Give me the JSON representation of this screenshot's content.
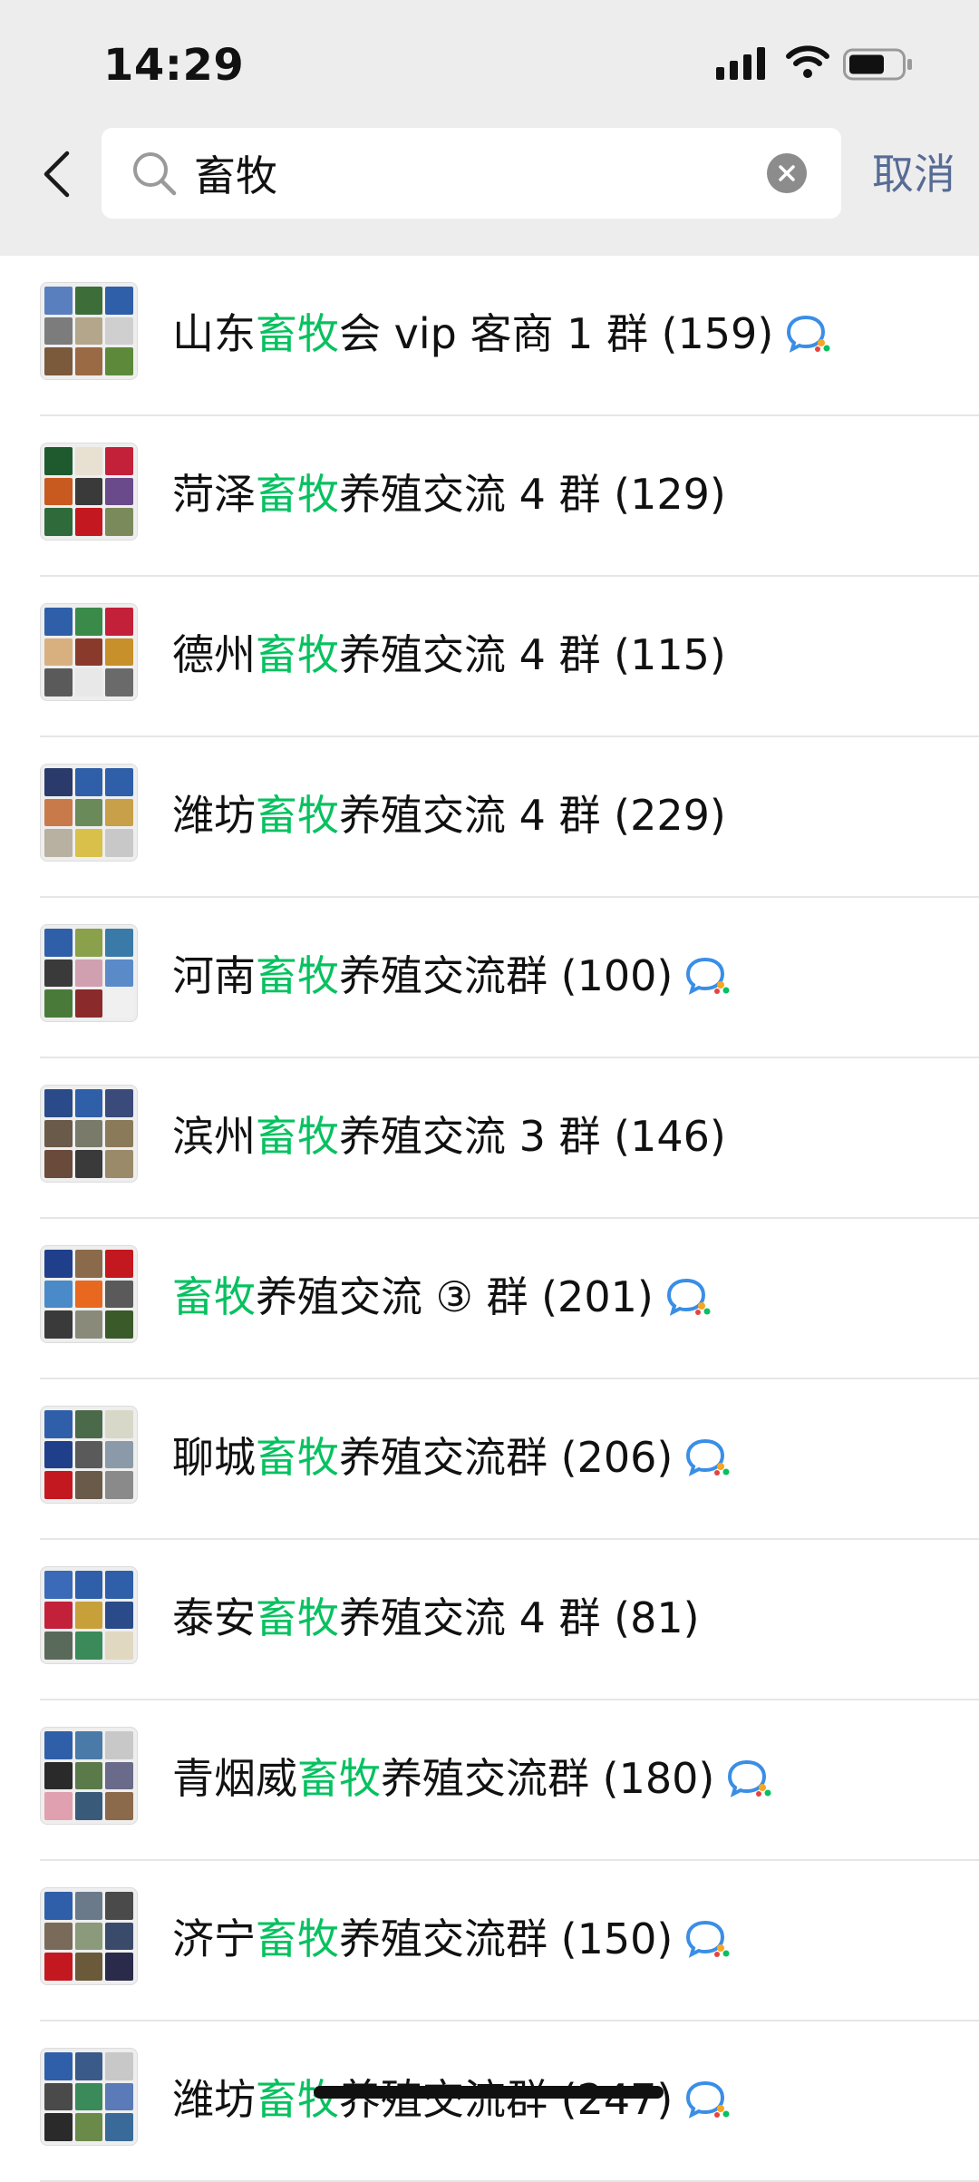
{
  "status_bar": {
    "time": "14:29"
  },
  "search": {
    "query": "畜牧",
    "cancel_label": "取消"
  },
  "results": [
    {
      "prefix": "山东",
      "keyword": "畜牧",
      "suffix": "会 vip 客商 1 群 (159)",
      "enterprise_badge": true,
      "avatar_colors": [
        "#5a7fbf",
        "#3d6e3a",
        "#2f5fa8",
        "#7c7c7c",
        "#b3a68a",
        "#cfcfcf",
        "#7a5a3b",
        "#9a6a44",
        "#5c8a3a"
      ]
    },
    {
      "prefix": "菏泽",
      "keyword": "畜牧",
      "suffix": "养殖交流 4 群 (129)",
      "enterprise_badge": false,
      "avatar_colors": [
        "#1f5a2e",
        "#e8e0d0",
        "#c3203a",
        "#c85a1f",
        "#3a3a3a",
        "#6a4a8a",
        "#2f6a3a",
        "#c3181f",
        "#7a8a5a"
      ]
    },
    {
      "prefix": "德州",
      "keyword": "畜牧",
      "suffix": "养殖交流 4 群 (115)",
      "enterprise_badge": false,
      "avatar_colors": [
        "#2f5fa8",
        "#3a8a4a",
        "#c3203a",
        "#d8b080",
        "#8a3a2a",
        "#c8902a",
        "#5a5a5a",
        "#e8e8e8",
        "#6a6a6a"
      ]
    },
    {
      "prefix": "潍坊",
      "keyword": "畜牧",
      "suffix": "养殖交流 4 群 (229)",
      "enterprise_badge": false,
      "avatar_colors": [
        "#2a3a6a",
        "#2f5fa8",
        "#2f5fa8",
        "#c87a4a",
        "#6a8a5a",
        "#c8a04a",
        "#b8b0a0",
        "#d8c04a",
        "#c8c8c8"
      ]
    },
    {
      "prefix": "河南",
      "keyword": "畜牧",
      "suffix": "养殖交流群 (100)",
      "enterprise_badge": true,
      "avatar_colors": [
        "#2f5fa8",
        "#8aa04a",
        "#3a7aa8",
        "#3a3a3a",
        "#d0a0b0",
        "#5a8ac8",
        "#4a7a3a",
        "#8a2a2a",
        "#f0f0f0"
      ]
    },
    {
      "prefix": "滨州",
      "keyword": "畜牧",
      "suffix": "养殖交流 3 群 (146)",
      "enterprise_badge": false,
      "avatar_colors": [
        "#2a4a8a",
        "#2f5fa8",
        "#3a4a7a",
        "#6a5a4a",
        "#7a7a6a",
        "#8a7a5a",
        "#6a4a3a",
        "#3a3a3a",
        "#9a8a6a"
      ]
    },
    {
      "prefix": "",
      "keyword": "畜牧",
      "suffix": "养殖交流 ③ 群 (201)",
      "enterprise_badge": true,
      "avatar_colors": [
        "#1f3f8a",
        "#8a6a4a",
        "#c3181f",
        "#4a8ac8",
        "#e8681f",
        "#5a5a5a",
        "#3a3a3a",
        "#8a8a7a",
        "#3a5a2a"
      ]
    },
    {
      "prefix": "聊城",
      "keyword": "畜牧",
      "suffix": "养殖交流群 (206)",
      "enterprise_badge": true,
      "avatar_colors": [
        "#2f5fa8",
        "#4a6a4a",
        "#d8d8c8",
        "#1f3f8a",
        "#5a5a5a",
        "#8a9aa8",
        "#c3181f",
        "#6a5a4a",
        "#8a8a8a"
      ]
    },
    {
      "prefix": "泰安",
      "keyword": "畜牧",
      "suffix": "养殖交流 4 群 (81)",
      "enterprise_badge": false,
      "avatar_colors": [
        "#3a6ab8",
        "#2f5fa8",
        "#2f5fa8",
        "#c3203a",
        "#c8a03a",
        "#2a4a8a",
        "#5a6a5a",
        "#3a8a5a",
        "#e0d8c0"
      ]
    },
    {
      "prefix": "青烟威",
      "keyword": "畜牧",
      "suffix": "养殖交流群 (180)",
      "enterprise_badge": true,
      "avatar_colors": [
        "#2f5fa8",
        "#4a7aa8",
        "#c8c8c8",
        "#2a2a2a",
        "#5a7a4a",
        "#6a6a8a",
        "#e0a0b0",
        "#3a5a7a",
        "#8a6a4a"
      ]
    },
    {
      "prefix": "济宁",
      "keyword": "畜牧",
      "suffix": "养殖交流群 (150)",
      "enterprise_badge": true,
      "avatar_colors": [
        "#2f5fa8",
        "#6a7a8a",
        "#4a4a4a",
        "#7a6a5a",
        "#8a9a7a",
        "#3a4a6a",
        "#c3181f",
        "#6a5a3a",
        "#2a2a4a"
      ]
    },
    {
      "prefix": "潍坊",
      "keyword": "畜牧",
      "suffix": "养殖交流群 (247)",
      "enterprise_badge": true,
      "avatar_colors": [
        "#2f5fa8",
        "#3a5a8a",
        "#c8c8c8",
        "#4a4a4a",
        "#3a8a5a",
        "#5a7ab8",
        "#2a2a2a",
        "#6a8a4a",
        "#3a6a9a"
      ]
    }
  ],
  "colors": {
    "highlight": "#07c160",
    "cancel": "#576b95",
    "header_bg": "#ededed"
  }
}
